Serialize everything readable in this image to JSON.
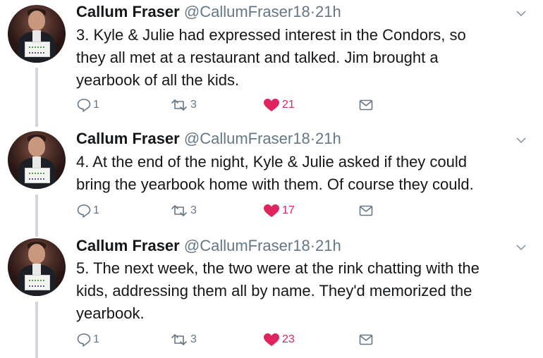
{
  "colors": {
    "like": "#e0245e",
    "muted": "#657786",
    "text": "#14171a",
    "thread_line": "#d0d6db"
  },
  "tweets": [
    {
      "name": "Callum Fraser",
      "handle": "@CallumFraser18",
      "separator": "·",
      "time": "21h",
      "lines": [
        "3. Kyle & Julie had expressed interest in the Condors, so",
        "they all met at a restaurant and talked. Jim brought a",
        "yearbook of all the kids."
      ],
      "replies": "1",
      "retweets": "3",
      "likes": "21",
      "liked": true
    },
    {
      "name": "Callum Fraser",
      "handle": "@CallumFraser18",
      "separator": "·",
      "time": "21h",
      "lines": [
        "4. At the end of the night, Kyle & Julie asked if they could",
        "bring the yearbook home with them. Of course they could."
      ],
      "replies": "1",
      "retweets": "3",
      "likes": "17",
      "liked": true
    },
    {
      "name": "Callum Fraser",
      "handle": "@CallumFraser18",
      "separator": "·",
      "time": "21h",
      "lines": [
        "5. The next week, the two were at the rink chatting with the",
        "kids, addressing them all by name. They'd memorized the",
        "yearbook."
      ],
      "replies": "1",
      "retweets": "3",
      "likes": "23",
      "liked": true
    }
  ],
  "icons": {
    "reply": "reply-icon",
    "retweet": "retweet-icon",
    "like": "heart-icon",
    "message": "envelope-icon",
    "caret": "chevron-down-icon"
  }
}
